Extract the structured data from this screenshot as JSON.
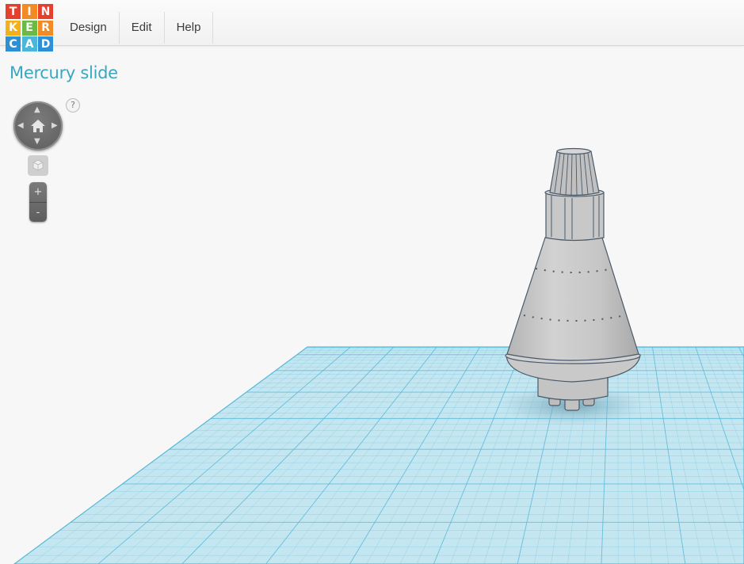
{
  "logo": {
    "letters": [
      {
        "char": "T",
        "color": "#e4402d"
      },
      {
        "char": "I",
        "color": "#f28b26"
      },
      {
        "char": "N",
        "color": "#e4402d"
      },
      {
        "char": "K",
        "color": "#f2b11b"
      },
      {
        "char": "E",
        "color": "#6cb946"
      },
      {
        "char": "R",
        "color": "#f28b26"
      },
      {
        "char": "C",
        "color": "#2d8fd5"
      },
      {
        "char": "A",
        "color": "#4ab6d9"
      },
      {
        "char": "D",
        "color": "#2d8fd5"
      }
    ]
  },
  "menu": {
    "design": "Design",
    "edit": "Edit",
    "help": "Help"
  },
  "design_title": "Mercury slide",
  "view_controls": {
    "help": "?",
    "zoom_in": "+",
    "zoom_out": "-",
    "arrow_up": "▲",
    "arrow_down": "▼",
    "arrow_left": "◀",
    "arrow_right": "▶"
  },
  "colors": {
    "accent": "#3aa7c1",
    "grid_fill": "#bfe3ef",
    "grid_line": "#57b8d8",
    "model_fill": "#c8c8c8",
    "model_stroke": "#4a5a6a"
  }
}
